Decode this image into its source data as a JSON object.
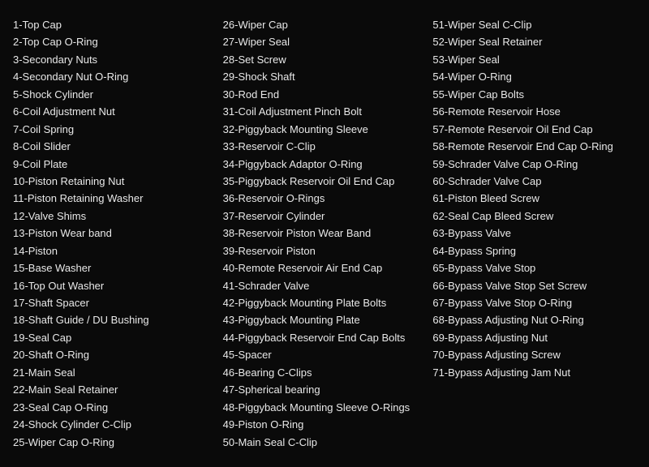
{
  "columns": [
    {
      "items": [
        "1-Top Cap",
        "2-Top Cap O-Ring",
        "3-Secondary Nuts",
        "4-Secondary Nut O-Ring",
        "5-Shock Cylinder",
        "6-Coil Adjustment Nut",
        "7-Coil Spring",
        "8-Coil Slider",
        "9-Coil Plate",
        "10-Piston Retaining Nut",
        "11-Piston Retaining Washer",
        "12-Valve Shims",
        "13-Piston Wear band",
        "14-Piston",
        "15-Base Washer",
        "16-Top Out Washer",
        "17-Shaft Spacer",
        "18-Shaft Guide / DU Bushing",
        "19-Seal Cap",
        "20-Shaft O-Ring",
        "21-Main Seal",
        "22-Main Seal Retainer",
        "23-Seal Cap O-Ring",
        "24-Shock Cylinder C-Clip",
        "25-Wiper Cap O-Ring"
      ]
    },
    {
      "items": [
        "26-Wiper Cap",
        "27-Wiper Seal",
        "28-Set Screw",
        "29-Shock Shaft",
        "30-Rod End",
        "31-Coil Adjustment Pinch Bolt",
        "32-Piggyback Mounting Sleeve",
        "33-Reservoir C-Clip",
        "34-Piggyback Adaptor O-Ring",
        "35-Piggyback Reservoir Oil End Cap",
        "36-Reservoir O-Rings",
        "37-Reservoir Cylinder",
        "38-Reservoir Piston Wear Band",
        "39-Reservoir Piston",
        "40-Remote Reservoir Air End Cap",
        "41-Schrader Valve",
        "42-Piggyback Mounting Plate Bolts",
        "43-Piggyback Mounting Plate",
        "44-Piggyback Reservoir End Cap Bolts",
        "45-Spacer",
        "46-Bearing C-Clips",
        "47-Spherical bearing",
        "48-Piggyback Mounting Sleeve O-Rings",
        "49-Piston O-Ring",
        "50-Main Seal C-Clip"
      ]
    },
    {
      "items": [
        "51-Wiper Seal C-Clip",
        "52-Wiper Seal Retainer",
        "53-Wiper Seal",
        "54-Wiper O-Ring",
        "55-Wiper Cap Bolts",
        "56-Remote Reservoir Hose",
        "57-Remote Reservoir Oil End Cap",
        "58-Remote Reservoir End Cap O-Ring",
        "59-Schrader Valve Cap O-Ring",
        "60-Schrader Valve Cap",
        "61-Piston Bleed Screw",
        "62-Seal Cap Bleed Screw",
        "63-Bypass Valve",
        "64-Bypass Spring",
        "65-Bypass Valve Stop",
        "66-Bypass Valve Stop Set Screw",
        "67-Bypass Valve Stop O-Ring",
        "68-Bypass Adjusting Nut O-Ring",
        "69-Bypass Adjusting Nut",
        "70-Bypass Adjusting Screw",
        "71-Bypass Adjusting Jam Nut"
      ]
    }
  ]
}
